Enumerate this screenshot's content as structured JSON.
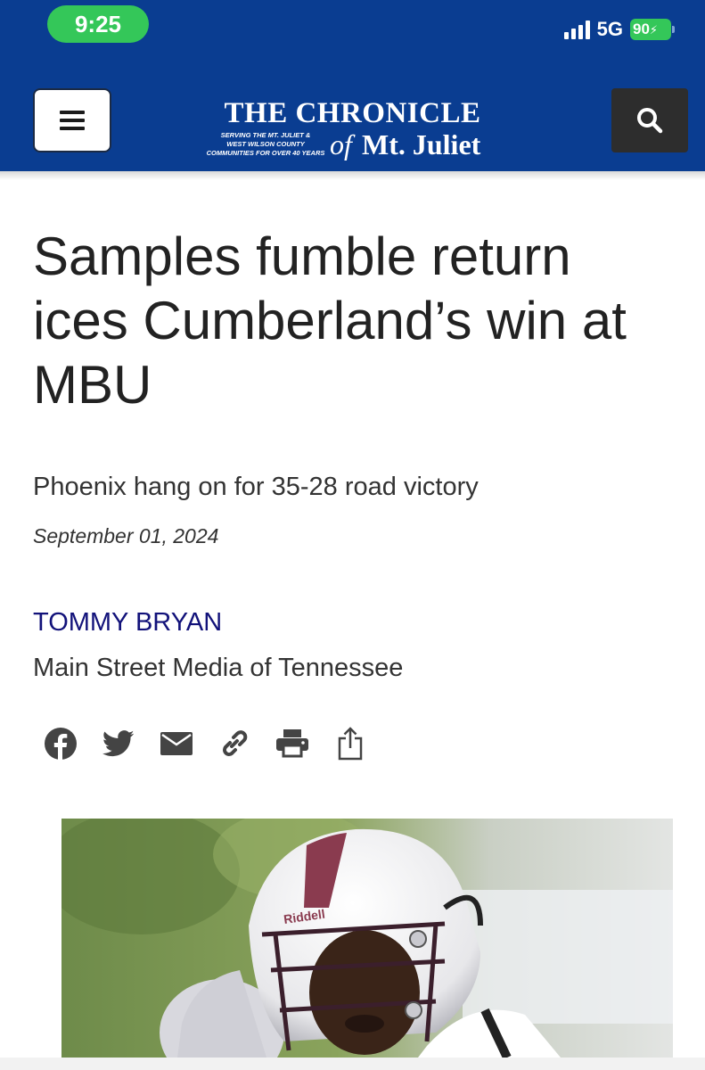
{
  "status_bar": {
    "time": "9:25",
    "network": "5G",
    "battery": "90",
    "colors": {
      "pill": "#34c759"
    }
  },
  "site": {
    "logo_name": "THE CHRONICLE",
    "logo_of": "of",
    "logo_city": "Mt. Juliet",
    "logo_tagline": [
      "SERVING THE MT. JULIET &",
      "WEST WILSON COUNTY",
      "COMMUNITIES FOR OVER 40 YEARS"
    ],
    "menu_icon": "hamburger-icon",
    "search_icon": "search-icon",
    "colors": {
      "header": "#0a3d91",
      "search_button": "#2d2d2d"
    }
  },
  "article": {
    "headline": "Samples fumble return ices Cumberland’s win at MBU",
    "subhead": "Phoenix hang on for 35-28 road victory",
    "date": "September 01, 2024",
    "author": "TOMMY BRYAN",
    "organization": "Main Street Media of Tennessee",
    "colors": {
      "author_link": "#12127a"
    }
  },
  "share": {
    "icons": [
      "facebook-icon",
      "twitter-icon",
      "email-icon",
      "link-icon",
      "print-icon",
      "share-icon"
    ]
  },
  "photo": {
    "helmet_brand": "Riddell"
  }
}
